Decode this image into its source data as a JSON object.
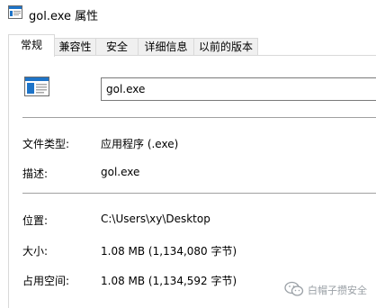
{
  "window": {
    "title": "gol.exe 属性"
  },
  "tabs": [
    {
      "label": "常规",
      "active": true
    },
    {
      "label": "兼容性",
      "active": false
    },
    {
      "label": "安全",
      "active": false
    },
    {
      "label": "详细信息",
      "active": false
    },
    {
      "label": "以前的版本",
      "active": false
    }
  ],
  "general": {
    "file_icon": "application-window-icon",
    "file_name": "gol.exe",
    "type_label": "文件类型:",
    "type_value": "应用程序 (.exe)",
    "description_label": "描述:",
    "description_value": "gol.exe",
    "location_label": "位置:",
    "location_value": "C:\\Users\\xy\\Desktop",
    "size_label": "大小:",
    "size_value": "1.08 MB (1,134,080 字节)",
    "disk_size_label": "占用空间:",
    "disk_size_value": "1.08 MB (1,134,592 字节)"
  },
  "watermark": {
    "text": "白帽子攒安全",
    "icon": "wechat-icon"
  },
  "colors": {
    "accent": "#1e74c8",
    "separator": "#a0a0a0",
    "tab_border": "#d9d9d9"
  }
}
